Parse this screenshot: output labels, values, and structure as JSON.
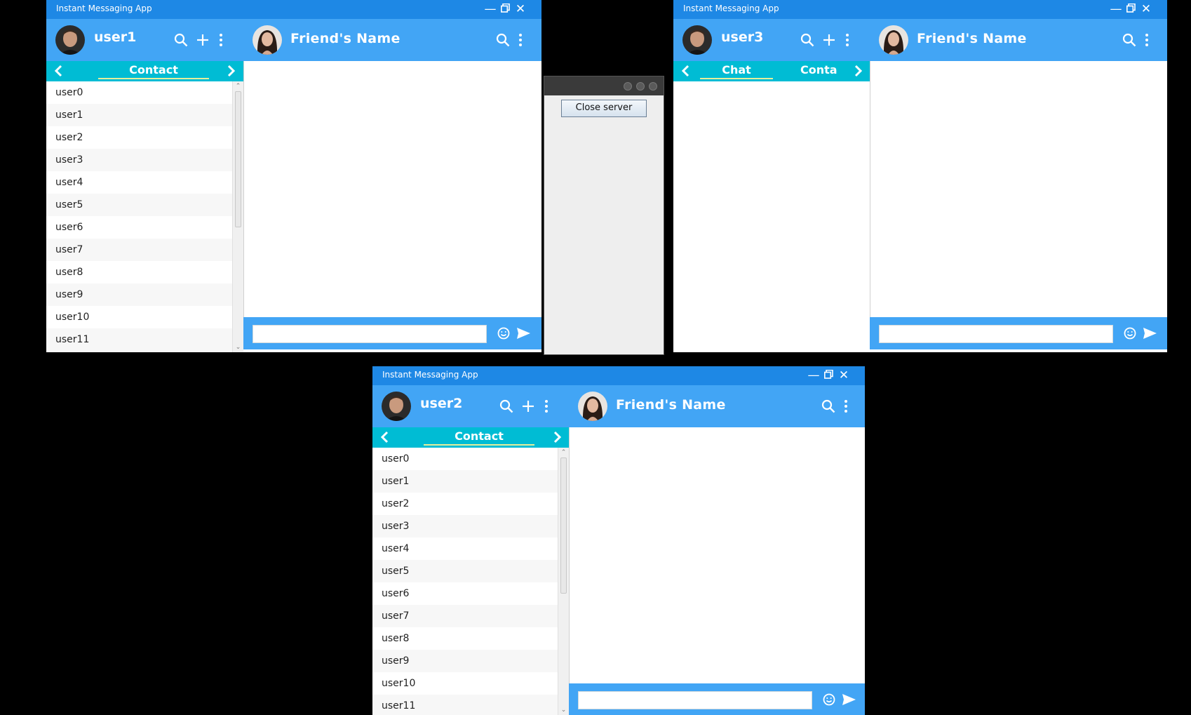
{
  "windows": [
    {
      "id": "w1",
      "title": "Instant Messaging App",
      "username": "user1",
      "friend_name": "Friend's Name",
      "tabs": {
        "active": "Contact",
        "secondary": ""
      },
      "contacts": [
        "user0",
        "user1",
        "user2",
        "user3",
        "user4",
        "user5",
        "user6",
        "user7",
        "user8",
        "user9",
        "user10",
        "user11"
      ],
      "message_input": ""
    },
    {
      "id": "w2",
      "title": "Instant Messaging App",
      "username": "user3",
      "friend_name": "Friend's Name",
      "tabs": {
        "active": "Chat",
        "secondary": "Conta"
      },
      "contacts": [],
      "message_input": ""
    },
    {
      "id": "w3",
      "title": "Instant Messaging App",
      "username": "user2",
      "friend_name": "Friend's Name",
      "tabs": {
        "active": "Contact",
        "secondary": ""
      },
      "contacts": [
        "user0",
        "user1",
        "user2",
        "user3",
        "user4",
        "user5",
        "user6",
        "user7",
        "user8",
        "user9",
        "user10",
        "user11"
      ],
      "message_input": ""
    }
  ],
  "server_window": {
    "close_button_label": "Close server"
  },
  "icons": {
    "window_controls": [
      "minimize-icon",
      "restore-icon",
      "close-icon"
    ],
    "header_left": [
      "search-icon",
      "add-icon",
      "more-vert-icon"
    ],
    "header_right": [
      "search-icon",
      "more-vert-icon"
    ],
    "tabbar": [
      "chevron-left-icon",
      "chevron-right-icon"
    ],
    "input": [
      "emoji-icon",
      "send-icon"
    ]
  },
  "colors": {
    "titlebar": "#1e88e5",
    "header": "#42a5f5",
    "tabbar": "#00bcd4",
    "tab_underline": "#e6ee9c",
    "background": "#000000"
  }
}
